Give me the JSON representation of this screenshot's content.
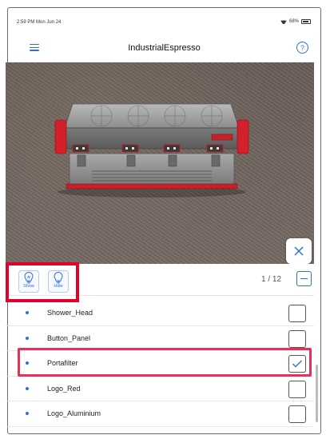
{
  "status_bar": {
    "time": "2:59 PM  Mon Jun 24",
    "battery": "68%"
  },
  "navbar": {
    "title": "IndustrialEspresso",
    "help_label": "?"
  },
  "viewer": {
    "model_name": "espresso-machine-3d-model"
  },
  "toolbar": {
    "show_label": "Show",
    "hide_label": "Hide",
    "counter": "1 / 12"
  },
  "parts": [
    {
      "name": "Shower_Head",
      "checked": false
    },
    {
      "name": "Button_Panel",
      "checked": false
    },
    {
      "name": "Portafilter",
      "checked": true
    },
    {
      "name": "Logo_Red",
      "checked": false
    },
    {
      "name": "Logo_Aluminium",
      "checked": false
    }
  ],
  "colors": {
    "accent": "#2f6fd3",
    "highlight_red": "#e3002a",
    "highlight_pink": "#e4335a",
    "floor": "#6f625c"
  }
}
